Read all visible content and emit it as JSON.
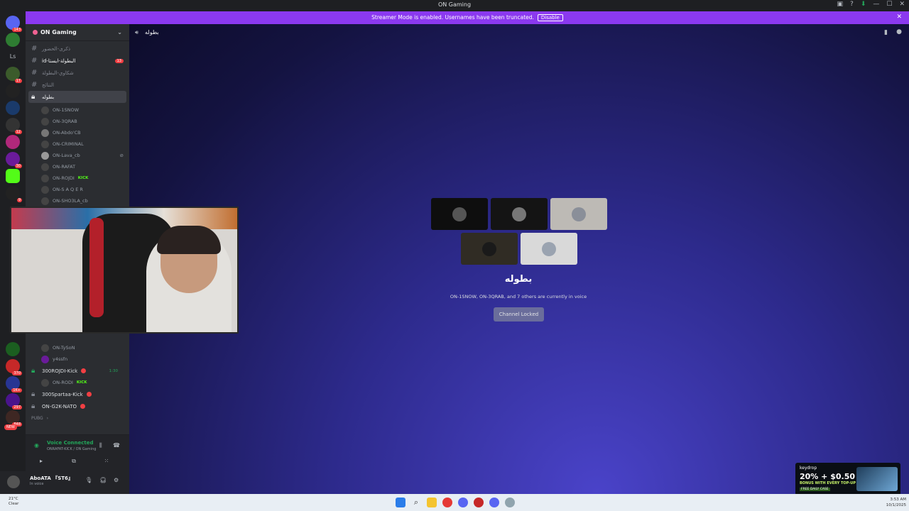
{
  "window": {
    "title": "ON Gaming"
  },
  "banner": {
    "text": "Streamer Mode is enabled. Usernames have been truncated.",
    "button": "Disable"
  },
  "server_list": {
    "badges": [
      "143",
      "17",
      "12",
      "2",
      "30",
      "1",
      "1",
      "9",
      "370",
      "1K+",
      "297",
      "848"
    ],
    "ls_label": "Ls",
    "new_label": "NEW"
  },
  "guild": {
    "name": "ON Gaming"
  },
  "channels": [
    {
      "name": "ذكرى-الحضور",
      "active": false
    },
    {
      "name": "id-البطولة-ايستا",
      "active": false,
      "badge": "13"
    },
    {
      "name": "شكاوي-البطولة",
      "active": false
    },
    {
      "name": "النتائج",
      "active": false
    },
    {
      "name": "بطوله",
      "active": true
    }
  ],
  "voice_users": [
    "ON-1SNOW",
    "ON-3QRAB",
    "ON-Abdo'CB",
    "ON-CRIMINAL",
    "ON-Lava_cb",
    "ON-RAFAT",
    "ON-ROJDI",
    "ON-S A Q E R",
    "ON-SHO3LA_cb"
  ],
  "voice_users_2": [
    "ON-TySoN",
    "y4ssfn"
  ],
  "kick_label": "KICK",
  "voice_channels": [
    {
      "name": "300ROJDI-Kick",
      "timer": "1:30",
      "user": "ON-RODI"
    },
    {
      "name": "300Spartaa-Kick"
    },
    {
      "name": "ON-G2K-NATO"
    }
  ],
  "category": "PUBG",
  "voice_panel": {
    "status": "Voice Connected",
    "channel": "ONRAFAT-KICK / ON Gaming"
  },
  "user": {
    "name": "AboATA 『ST6』",
    "status": "In voice"
  },
  "main": {
    "channel_name": "بطوله",
    "title": "بطوله",
    "subtitle": "ON-1SNOW, ON-3QRAB, and 7 others are currently in voice",
    "button": "Channel Locked",
    "tile_colors": [
      "#0e0e0e",
      "#141414",
      "#bdbab5",
      "#302c24",
      "#d9d9d9"
    ]
  },
  "promo": {
    "brand": "keydrop",
    "headline": "20% + $0.50",
    "sub": "BONUS WITH EVERY TOP-UP",
    "tag": "FREE DAILY CASE"
  },
  "taskbar": {
    "temp": "21°C",
    "weather": "Clear",
    "time": "3:53 AM",
    "date": "10/1/2025"
  }
}
